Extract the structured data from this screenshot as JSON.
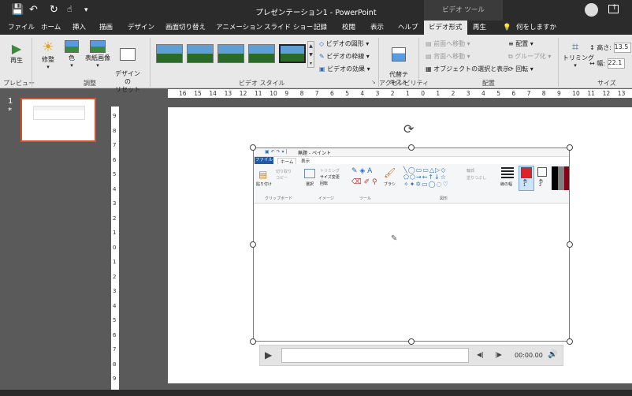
{
  "app": {
    "title": "プレゼンテーション1 - PowerPoint",
    "context_tab_title": "ビデオ ツール"
  },
  "tabs": [
    "ファイル",
    "ホーム",
    "挿入",
    "描画",
    "デザイン",
    "画面切り替え",
    "アニメーション",
    "スライド ショー",
    "記録",
    "校閲",
    "表示",
    "ヘルプ",
    "ビデオ形式",
    "再生"
  ],
  "tell_me": "何をしますか",
  "ribbon": {
    "preview_button": "再生",
    "adjust_buttons": [
      "修整",
      "色",
      "表紙画像",
      "デザインの\nリセット"
    ],
    "video_options": [
      "ビデオの図形",
      "ビデオの枠線",
      "ビデオの効果"
    ],
    "alt_text": "代替テ\nキスト",
    "arrange": {
      "forward": "前面へ移動",
      "backward": "背面へ移動",
      "selection_pane": "オブジェクトの選択と表示",
      "align": "配置",
      "group": "グループ化",
      "rotate": "回転"
    },
    "trim": "トリミング",
    "height_label": "高さ:",
    "height_value": "13.5",
    "width_label": "幅:",
    "width_value": "22.1",
    "groups": [
      "プレビュー",
      "調整",
      "ビデオ スタイル",
      "アクセシビリティ",
      "配置",
      "サイズ"
    ]
  },
  "slide_panel": {
    "number": "1",
    "star": "*"
  },
  "hruler": [
    "16",
    "15",
    "14",
    "13",
    "12",
    "11",
    "10",
    "9",
    "8",
    "7",
    "6",
    "5",
    "4",
    "3",
    "2",
    "1",
    "0",
    "1",
    "2",
    "3",
    "4",
    "5",
    "6",
    "7",
    "8",
    "9",
    "10",
    "11",
    "12",
    "13"
  ],
  "vruler": [
    "9",
    "8",
    "7",
    "6",
    "5",
    "4",
    "3",
    "2",
    "1",
    "0",
    "1",
    "2",
    "3",
    "4",
    "5",
    "6",
    "7",
    "8",
    "9"
  ],
  "paint": {
    "title": "無題 - ペイント",
    "tabs": [
      "ファイル",
      "ホーム",
      "表示"
    ],
    "paste": "貼り付け",
    "clipboard_items": [
      "切り取り",
      "コピー"
    ],
    "image_items": [
      "トリミング",
      "サイズ変更",
      "回転"
    ],
    "select": "選択",
    "brush": "ブラシ",
    "outline": "輪郭",
    "fill": "塗りつぶし",
    "size": "線の幅",
    "color1": "色\n1",
    "color2": "色\n2",
    "groups": [
      "クリップボード",
      "イメージ",
      "ツール",
      "図形"
    ]
  },
  "player": {
    "time": "00:00.00"
  },
  "colors": {
    "accent": "#d35230",
    "dark": "#2b2b2b"
  }
}
